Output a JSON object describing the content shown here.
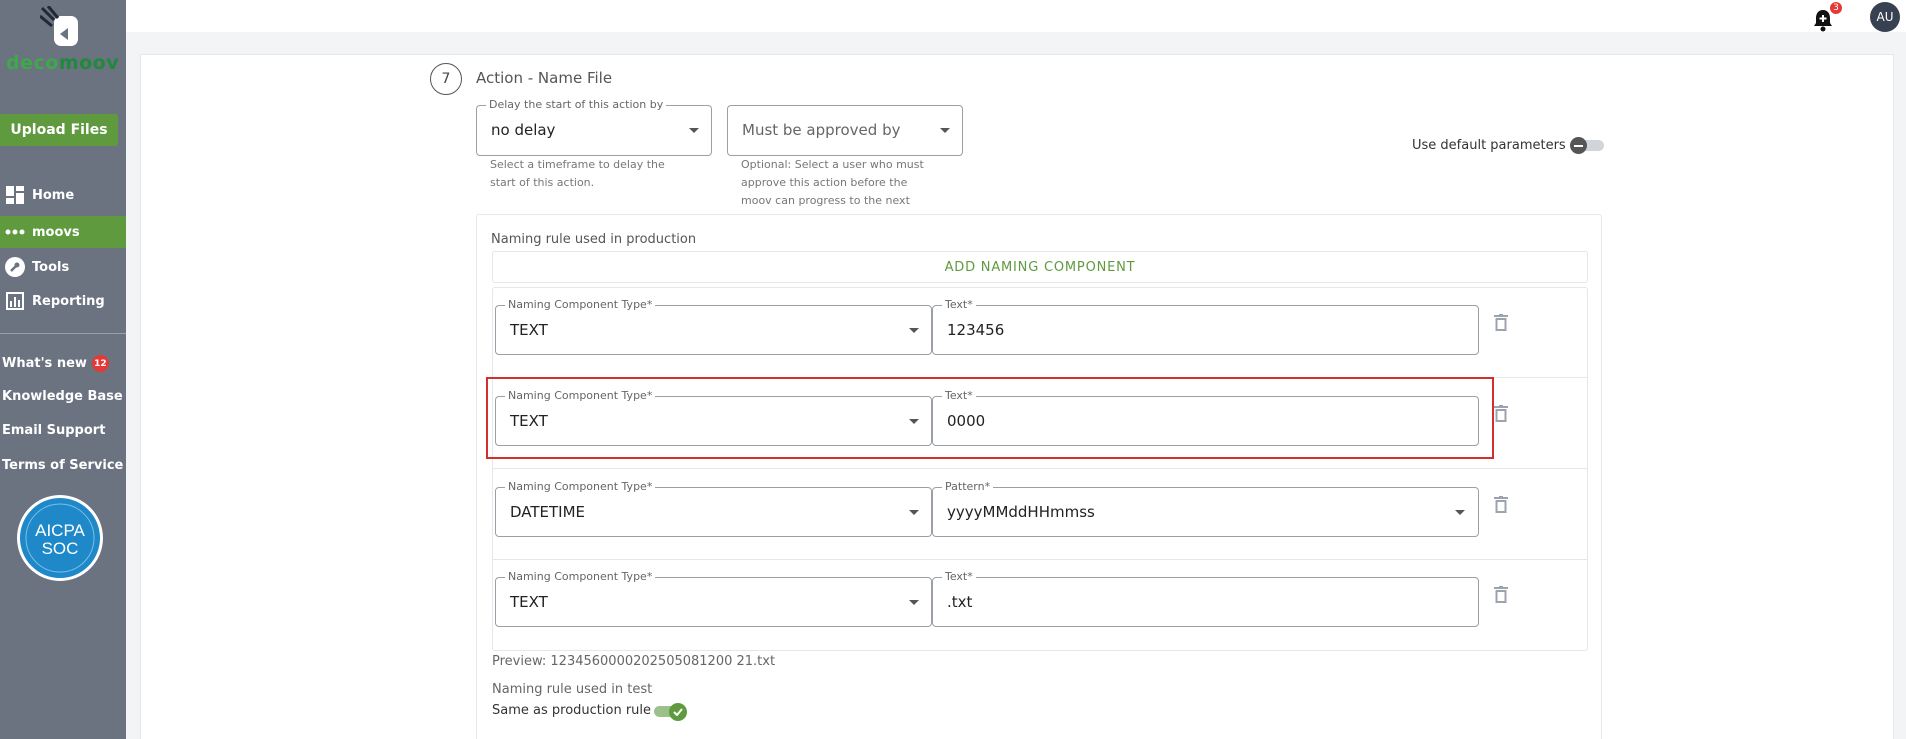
{
  "sidebar": {
    "logo": {
      "part1": "deco",
      "part2": "moov"
    },
    "upload_label": "Upload Files",
    "nav": [
      {
        "label": "Home",
        "icon": "dashboard-icon",
        "active": false
      },
      {
        "label": "moovs",
        "icon": "dots-icon",
        "active": true
      },
      {
        "label": "Tools",
        "icon": "wrench-icon",
        "active": false
      },
      {
        "label": "Reporting",
        "icon": "chart-icon",
        "active": false
      }
    ],
    "links": [
      {
        "label": "What's new",
        "badge": "12"
      },
      {
        "label": "Knowledge Base"
      },
      {
        "label": "Email Support"
      },
      {
        "label": "Terms of Service"
      }
    ],
    "aicpa": {
      "line1": "AICPA",
      "line2": "SOC"
    }
  },
  "topbar": {
    "notification_count": "3",
    "avatar_initials": "AU"
  },
  "step": {
    "number": "7",
    "title": "Action - Name File"
  },
  "delay": {
    "label": "Delay the start of this action by",
    "value": "no delay",
    "helper_line1": "Select a timeframe to delay the",
    "helper_line2": "start of this action."
  },
  "approval": {
    "placeholder": "Must be approved by",
    "helper_line1": "Optional: Select a user who must",
    "helper_line2": "approve this action before the",
    "helper_line3": "moov can progress to the next"
  },
  "default_params_label": "Use default parameters",
  "naming": {
    "title": "Naming rule used in production",
    "add_label": "ADD NAMING COMPONENT",
    "components": [
      {
        "type_label": "Naming Component Type*",
        "type": "TEXT",
        "value_label": "Text*",
        "value": "123456"
      },
      {
        "type_label": "Naming Component Type*",
        "type": "TEXT",
        "value_label": "Text*",
        "value": "0000"
      },
      {
        "type_label": "Naming Component Type*",
        "type": "DATETIME",
        "value_label": "Pattern*",
        "value": "yyyyMMddHHmmss"
      },
      {
        "type_label": "Naming Component Type*",
        "type": "TEXT",
        "value_label": "Text*",
        "value": ".txt"
      }
    ],
    "preview": "Preview: 1234560000202505081200 21.txt",
    "test_title": "Naming rule used in test",
    "same_as_label": "Same as production rule"
  },
  "colors": {
    "sidebar_bg": "#6b7280",
    "accent_green": "#5f9a3f",
    "highlight_red": "#d32f2f"
  }
}
